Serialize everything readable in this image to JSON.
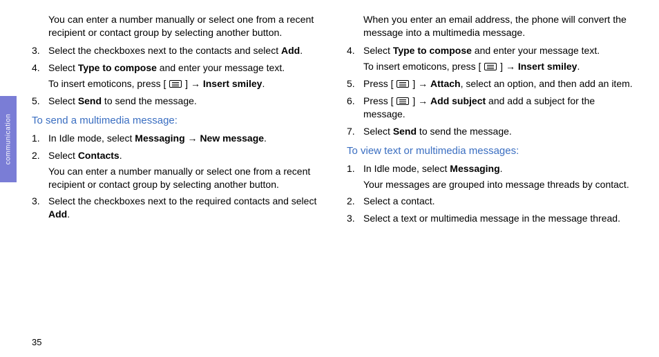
{
  "thumb_label": "communication",
  "page_number": "35",
  "glyphs": {
    "arrow": "→"
  },
  "left": {
    "intro": "You can enter a number manually or select one from a recent recipient or contact group by selecting another button.",
    "items_a": [
      {
        "n": "3.",
        "pre": "Select the checkboxes next to the contacts and select ",
        "bold": "Add",
        "post": "."
      },
      {
        "n": "4.",
        "pre": "Select ",
        "bold": "Type to compose",
        "post": " and enter your message text.",
        "sub_pre": "To insert emoticons, press [ ",
        "sub_icon": true,
        "sub_mid": " ] ",
        "sub_arrow": true,
        "sub_bold": "Insert smiley",
        "sub_end": "."
      },
      {
        "n": "5.",
        "pre": "Select ",
        "bold": "Send",
        "post": " to send the message."
      }
    ],
    "heading": "To send a multimedia message:",
    "items_b": [
      {
        "n": "1.",
        "pre": "In Idle mode, select ",
        "bold": "Messaging",
        "mid": " ",
        "arrow": true,
        "bold2": "New message",
        "post": "."
      },
      {
        "n": "2.",
        "pre": "Select ",
        "bold": "Contacts",
        "post": ".",
        "sub": "You can enter a number manually or select one from a recent recipient or contact group by selecting another button."
      },
      {
        "n": "3.",
        "pre": "Select the checkboxes next to the required contacts and select ",
        "bold": "Add",
        "post": "."
      }
    ]
  },
  "right": {
    "intro": "When you enter an email address, the phone will convert the message into a multimedia message.",
    "items_a": [
      {
        "n": "4.",
        "pre": "Select ",
        "bold": "Type to compose",
        "post": " and enter your message text.",
        "sub_pre": "To insert emoticons, press [ ",
        "sub_icon": true,
        "sub_mid": " ] ",
        "sub_arrow": true,
        "sub_bold": "Insert smiley",
        "sub_end": "."
      },
      {
        "n": "5.",
        "pre": "Press [ ",
        "icon": true,
        "mid": " ] ",
        "arrow": true,
        "bold": "Attach",
        "post": ", select an option, and then add an item."
      },
      {
        "n": "6.",
        "pre": "Press [ ",
        "icon": true,
        "mid": " ] ",
        "arrow": true,
        "bold": "Add subject",
        "post": " and add a subject for the message."
      },
      {
        "n": "7.",
        "pre": "Select ",
        "bold": "Send",
        "post": " to send the message."
      }
    ],
    "heading": "To view text or multimedia messages:",
    "items_b": [
      {
        "n": "1.",
        "pre": "In Idle mode, select ",
        "bold": "Messaging",
        "post": ".",
        "sub": "Your messages are grouped into message threads by contact."
      },
      {
        "n": "2.",
        "pre": "Select a contact."
      },
      {
        "n": "3.",
        "pre": "Select a text or multimedia message in the message thread."
      }
    ]
  }
}
